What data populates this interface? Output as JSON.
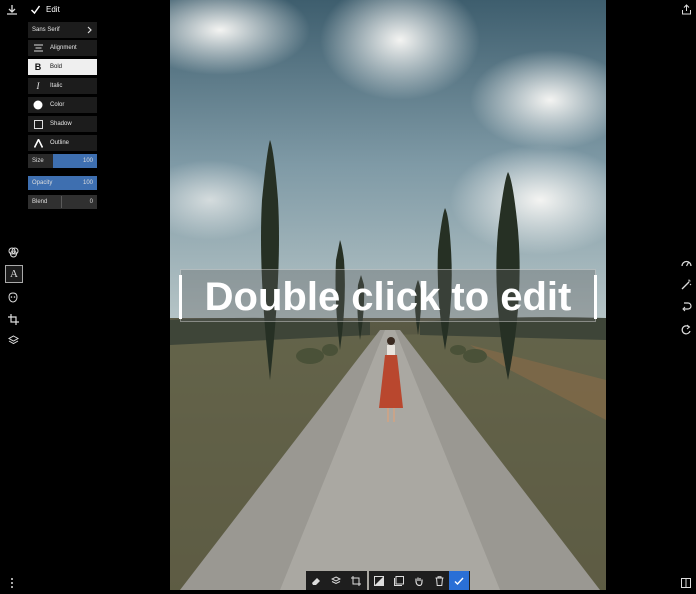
{
  "header": {
    "title": "Edit"
  },
  "panel": {
    "font": "Sans Serif",
    "items": [
      {
        "label": "Alignment",
        "icon": "align-icon"
      },
      {
        "label": "Bold",
        "icon": "bold-icon",
        "selected": true
      },
      {
        "label": "Italic",
        "icon": "italic-icon"
      },
      {
        "label": "Color",
        "icon": "color-swatch-icon"
      },
      {
        "label": "Shadow",
        "icon": "shadow-icon"
      },
      {
        "label": "Outline",
        "icon": "outline-icon"
      }
    ],
    "size": {
      "label": "Size",
      "value": "100",
      "fill": 0.35
    },
    "opacity": {
      "label": "Opacity",
      "value": "100",
      "fill": 1.0
    },
    "blend": {
      "label": "Blend",
      "value": "0",
      "fill": 0.5
    }
  },
  "canvas": {
    "text": "Double click to edit"
  },
  "colors": {
    "accent": "#3e6fb0",
    "confirm": "#2a6fd6"
  }
}
